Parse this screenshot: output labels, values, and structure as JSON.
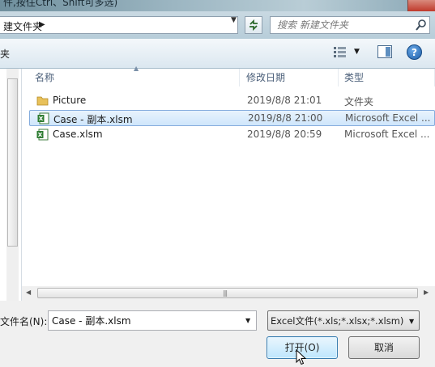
{
  "window": {
    "title_fragment": "件,按住Ctrl、Shift可多选)"
  },
  "address": {
    "breadcrumb": "建文件夹",
    "search_placeholder": "搜索 新建文件夹"
  },
  "toolbar": {
    "label": "夹"
  },
  "columns": {
    "name": "名称",
    "date": "修改日期",
    "type": "类型"
  },
  "files": [
    {
      "name": "Picture",
      "date": "2019/8/8 21:01",
      "type": "文件夹",
      "icon": "folder-icon",
      "selected": false
    },
    {
      "name": "Case - 副本.xlsm",
      "date": "2019/8/8 21:00",
      "type": "Microsoft Excel ...",
      "icon": "excel-file-icon",
      "selected": true
    },
    {
      "name": "Case.xlsm",
      "date": "2019/8/8 20:59",
      "type": "Microsoft Excel ...",
      "icon": "excel-file-icon",
      "selected": false
    }
  ],
  "bottom": {
    "filename_label": "文件名(N):",
    "filename_value": "Case - 副本.xlsm",
    "filetype_value": "Excel文件(*.xls;*.xlsx;*.xlsm)",
    "open_label": "打开(O)",
    "cancel_label": "取消"
  },
  "colors": {
    "selection": "#cfe6fb",
    "selection_border": "#84acdd",
    "header_text": "#4c607a"
  }
}
